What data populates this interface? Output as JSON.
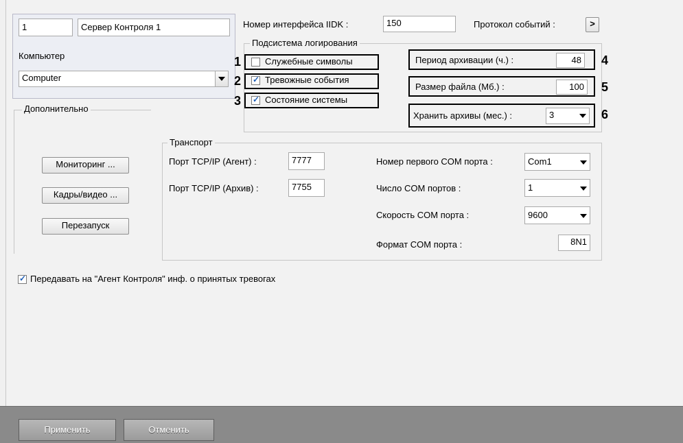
{
  "server": {
    "id": "1",
    "name": "Сервер Контроля 1",
    "computer_label": "Компьютер",
    "computer_value": "Computer"
  },
  "extra": {
    "group_label": "Дополнительно",
    "monitoring": "Мониторинг ...",
    "frames": "Кадры/видео ...",
    "restart": "Перезапуск"
  },
  "iidk": {
    "label": "Номер интерфейса IIDK :",
    "value": "150",
    "protocol_label": "Протокол событий :",
    "protocol_button": ">"
  },
  "logging": {
    "group_label": "Подсистема логирования",
    "service_symbols": "Служебные символы",
    "service_checked": false,
    "alarm_events": "Тревожные события",
    "alarm_checked": true,
    "system_state": "Состояние системы",
    "system_checked": true,
    "archive_period_label": "Период архивации (ч.) :",
    "archive_period": "48",
    "file_size_label": "Размер файла (Мб.) :",
    "file_size": "100",
    "keep_label": "Хранить архивы (мес.) :",
    "keep_value": "3"
  },
  "markers": [
    "1",
    "2",
    "3",
    "4",
    "5",
    "6"
  ],
  "transport": {
    "group_label": "Транспорт",
    "tcp_agent_label": "Порт TCP/IP (Агент) :",
    "tcp_agent": "7777",
    "tcp_archive_label": "Порт TCP/IP (Архив) :",
    "tcp_archive": "7755",
    "com_first_label": "Номер первого COM порта :",
    "com_first": "Com1",
    "com_count_label": "Число COM портов :",
    "com_count": "1",
    "com_speed_label": "Скорость COM порта :",
    "com_speed": "9600",
    "com_format_label": "Формат COM порта :",
    "com_format": "8N1"
  },
  "forward_alarms": {
    "label": "Передавать на \"Агент Контроля\" инф. о принятых тревогах",
    "checked": true
  },
  "footer": {
    "apply": "Применить",
    "cancel": "Отменить"
  }
}
